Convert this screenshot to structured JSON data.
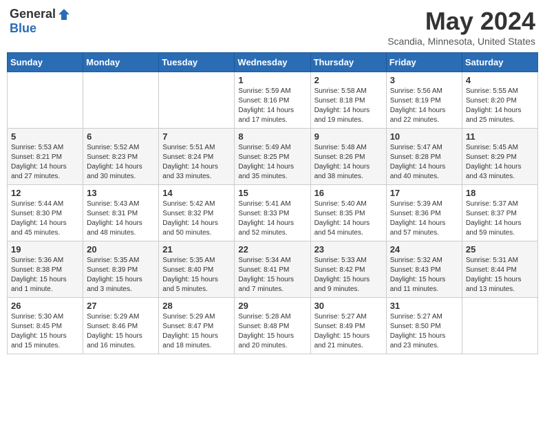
{
  "header": {
    "logo": {
      "general": "General",
      "blue": "Blue"
    },
    "title": "May 2024",
    "location": "Scandia, Minnesota, United States"
  },
  "weekdays": [
    "Sunday",
    "Monday",
    "Tuesday",
    "Wednesday",
    "Thursday",
    "Friday",
    "Saturday"
  ],
  "weeks": [
    [
      {
        "day": "",
        "sunrise": "",
        "sunset": "",
        "daylight": ""
      },
      {
        "day": "",
        "sunrise": "",
        "sunset": "",
        "daylight": ""
      },
      {
        "day": "",
        "sunrise": "",
        "sunset": "",
        "daylight": ""
      },
      {
        "day": "1",
        "sunrise": "Sunrise: 5:59 AM",
        "sunset": "Sunset: 8:16 PM",
        "daylight": "Daylight: 14 hours and 17 minutes."
      },
      {
        "day": "2",
        "sunrise": "Sunrise: 5:58 AM",
        "sunset": "Sunset: 8:18 PM",
        "daylight": "Daylight: 14 hours and 19 minutes."
      },
      {
        "day": "3",
        "sunrise": "Sunrise: 5:56 AM",
        "sunset": "Sunset: 8:19 PM",
        "daylight": "Daylight: 14 hours and 22 minutes."
      },
      {
        "day": "4",
        "sunrise": "Sunrise: 5:55 AM",
        "sunset": "Sunset: 8:20 PM",
        "daylight": "Daylight: 14 hours and 25 minutes."
      }
    ],
    [
      {
        "day": "5",
        "sunrise": "Sunrise: 5:53 AM",
        "sunset": "Sunset: 8:21 PM",
        "daylight": "Daylight: 14 hours and 27 minutes."
      },
      {
        "day": "6",
        "sunrise": "Sunrise: 5:52 AM",
        "sunset": "Sunset: 8:23 PM",
        "daylight": "Daylight: 14 hours and 30 minutes."
      },
      {
        "day": "7",
        "sunrise": "Sunrise: 5:51 AM",
        "sunset": "Sunset: 8:24 PM",
        "daylight": "Daylight: 14 hours and 33 minutes."
      },
      {
        "day": "8",
        "sunrise": "Sunrise: 5:49 AM",
        "sunset": "Sunset: 8:25 PM",
        "daylight": "Daylight: 14 hours and 35 minutes."
      },
      {
        "day": "9",
        "sunrise": "Sunrise: 5:48 AM",
        "sunset": "Sunset: 8:26 PM",
        "daylight": "Daylight: 14 hours and 38 minutes."
      },
      {
        "day": "10",
        "sunrise": "Sunrise: 5:47 AM",
        "sunset": "Sunset: 8:28 PM",
        "daylight": "Daylight: 14 hours and 40 minutes."
      },
      {
        "day": "11",
        "sunrise": "Sunrise: 5:45 AM",
        "sunset": "Sunset: 8:29 PM",
        "daylight": "Daylight: 14 hours and 43 minutes."
      }
    ],
    [
      {
        "day": "12",
        "sunrise": "Sunrise: 5:44 AM",
        "sunset": "Sunset: 8:30 PM",
        "daylight": "Daylight: 14 hours and 45 minutes."
      },
      {
        "day": "13",
        "sunrise": "Sunrise: 5:43 AM",
        "sunset": "Sunset: 8:31 PM",
        "daylight": "Daylight: 14 hours and 48 minutes."
      },
      {
        "day": "14",
        "sunrise": "Sunrise: 5:42 AM",
        "sunset": "Sunset: 8:32 PM",
        "daylight": "Daylight: 14 hours and 50 minutes."
      },
      {
        "day": "15",
        "sunrise": "Sunrise: 5:41 AM",
        "sunset": "Sunset: 8:33 PM",
        "daylight": "Daylight: 14 hours and 52 minutes."
      },
      {
        "day": "16",
        "sunrise": "Sunrise: 5:40 AM",
        "sunset": "Sunset: 8:35 PM",
        "daylight": "Daylight: 14 hours and 54 minutes."
      },
      {
        "day": "17",
        "sunrise": "Sunrise: 5:39 AM",
        "sunset": "Sunset: 8:36 PM",
        "daylight": "Daylight: 14 hours and 57 minutes."
      },
      {
        "day": "18",
        "sunrise": "Sunrise: 5:37 AM",
        "sunset": "Sunset: 8:37 PM",
        "daylight": "Daylight: 14 hours and 59 minutes."
      }
    ],
    [
      {
        "day": "19",
        "sunrise": "Sunrise: 5:36 AM",
        "sunset": "Sunset: 8:38 PM",
        "daylight": "Daylight: 15 hours and 1 minute."
      },
      {
        "day": "20",
        "sunrise": "Sunrise: 5:35 AM",
        "sunset": "Sunset: 8:39 PM",
        "daylight": "Daylight: 15 hours and 3 minutes."
      },
      {
        "day": "21",
        "sunrise": "Sunrise: 5:35 AM",
        "sunset": "Sunset: 8:40 PM",
        "daylight": "Daylight: 15 hours and 5 minutes."
      },
      {
        "day": "22",
        "sunrise": "Sunrise: 5:34 AM",
        "sunset": "Sunset: 8:41 PM",
        "daylight": "Daylight: 15 hours and 7 minutes."
      },
      {
        "day": "23",
        "sunrise": "Sunrise: 5:33 AM",
        "sunset": "Sunset: 8:42 PM",
        "daylight": "Daylight: 15 hours and 9 minutes."
      },
      {
        "day": "24",
        "sunrise": "Sunrise: 5:32 AM",
        "sunset": "Sunset: 8:43 PM",
        "daylight": "Daylight: 15 hours and 11 minutes."
      },
      {
        "day": "25",
        "sunrise": "Sunrise: 5:31 AM",
        "sunset": "Sunset: 8:44 PM",
        "daylight": "Daylight: 15 hours and 13 minutes."
      }
    ],
    [
      {
        "day": "26",
        "sunrise": "Sunrise: 5:30 AM",
        "sunset": "Sunset: 8:45 PM",
        "daylight": "Daylight: 15 hours and 15 minutes."
      },
      {
        "day": "27",
        "sunrise": "Sunrise: 5:29 AM",
        "sunset": "Sunset: 8:46 PM",
        "daylight": "Daylight: 15 hours and 16 minutes."
      },
      {
        "day": "28",
        "sunrise": "Sunrise: 5:29 AM",
        "sunset": "Sunset: 8:47 PM",
        "daylight": "Daylight: 15 hours and 18 minutes."
      },
      {
        "day": "29",
        "sunrise": "Sunrise: 5:28 AM",
        "sunset": "Sunset: 8:48 PM",
        "daylight": "Daylight: 15 hours and 20 minutes."
      },
      {
        "day": "30",
        "sunrise": "Sunrise: 5:27 AM",
        "sunset": "Sunset: 8:49 PM",
        "daylight": "Daylight: 15 hours and 21 minutes."
      },
      {
        "day": "31",
        "sunrise": "Sunrise: 5:27 AM",
        "sunset": "Sunset: 8:50 PM",
        "daylight": "Daylight: 15 hours and 23 minutes."
      },
      {
        "day": "",
        "sunrise": "",
        "sunset": "",
        "daylight": ""
      }
    ]
  ]
}
